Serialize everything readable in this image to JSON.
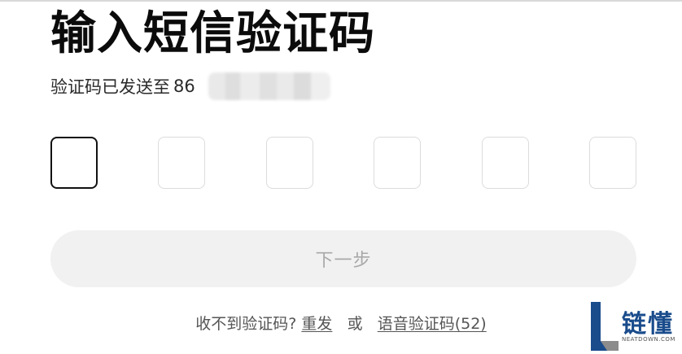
{
  "page": {
    "title": "输入短信验证码",
    "subtitle_prefix": "验证码已发送至",
    "country_code": "86",
    "phone_masked": true
  },
  "code_input": {
    "length": 6,
    "active_index": 0
  },
  "next_button": {
    "label": "下一步",
    "disabled": true
  },
  "resend": {
    "prompt": "收不到验证码?",
    "resend_label": "重发",
    "or_text": "或",
    "voice_label": "语音验证码(52)"
  },
  "watermark": {
    "text": "链懂",
    "sub": "NEATDOWN.COM",
    "icon": "L-logo-icon"
  },
  "colors": {
    "title": "#0b0b0b",
    "box_border": "#dcdcdc",
    "box_active_border": "#111111",
    "button_bg": "#f1f1f1",
    "button_text": "#a9a9a9",
    "watermark_blue": "#1a4c8c"
  }
}
